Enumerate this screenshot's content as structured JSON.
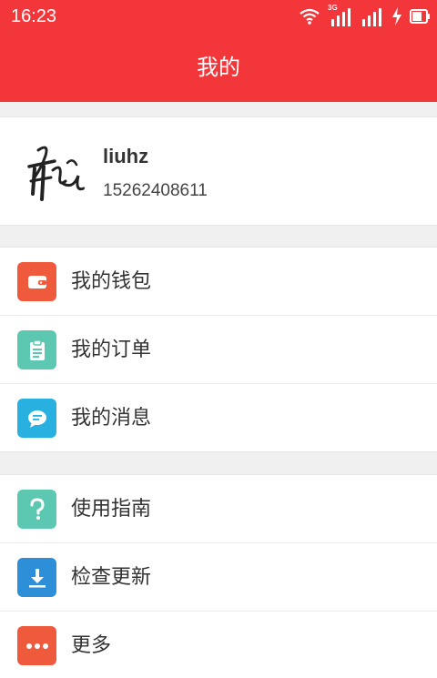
{
  "status_bar": {
    "time": "16:23",
    "network_label": "3G",
    "icons": [
      "wifi-icon",
      "signal-3g-icon",
      "signal-icon",
      "charging-icon",
      "battery-icon"
    ]
  },
  "header": {
    "title": "我的"
  },
  "profile": {
    "username": "liuhz",
    "phone": "15262408611",
    "avatar_icon": "handwritten-avatar"
  },
  "menu_group_1": [
    {
      "label": "我的钱包",
      "icon": "wallet-icon",
      "color": "#f05a3c"
    },
    {
      "label": "我的订单",
      "icon": "clipboard-icon",
      "color": "#5dc8b2"
    },
    {
      "label": "我的消息",
      "icon": "message-icon",
      "color": "#27b0e0"
    }
  ],
  "menu_group_2": [
    {
      "label": "使用指南",
      "icon": "question-icon",
      "color": "#5dc8b2"
    },
    {
      "label": "检查更新",
      "icon": "download-icon",
      "color": "#2c8fd8"
    },
    {
      "label": "更多",
      "icon": "more-icon",
      "color": "#f05a3c"
    }
  ],
  "colors": {
    "brand": "#f2363a",
    "background": "#f0f0f0"
  }
}
